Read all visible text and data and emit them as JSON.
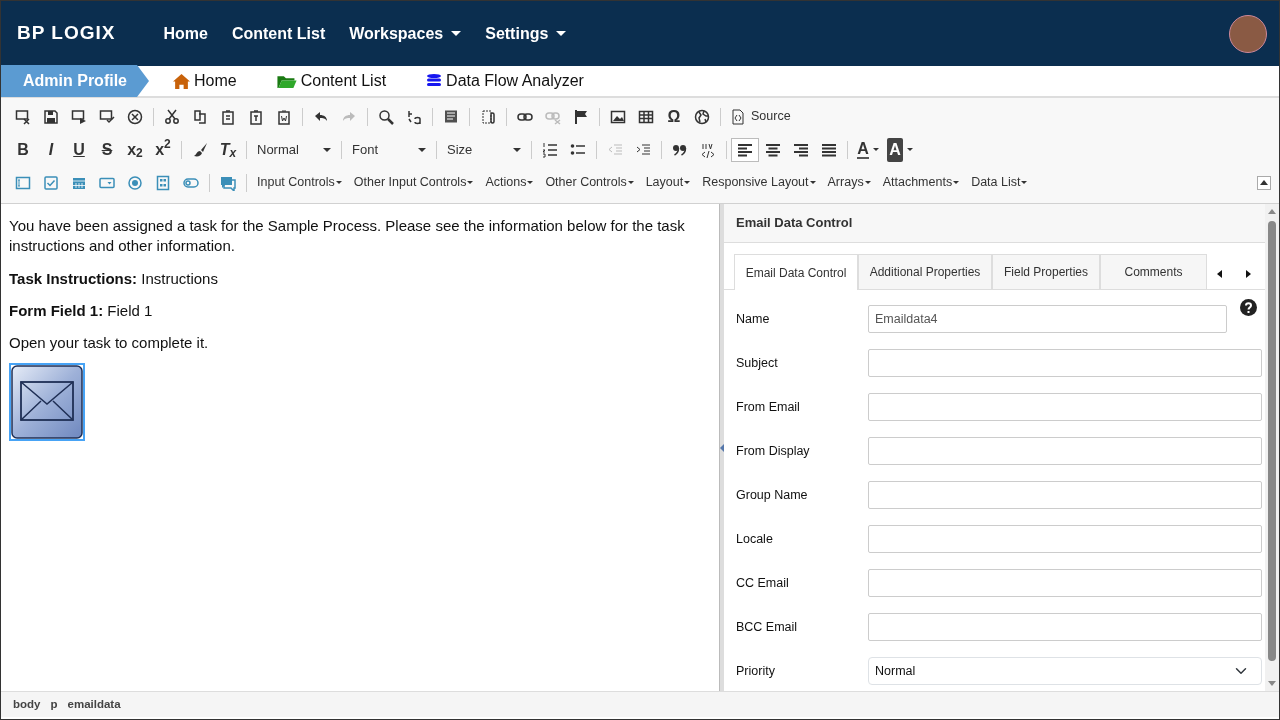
{
  "navbar": {
    "logo": "BP LOGIX",
    "items": [
      {
        "label": "Home",
        "dropdown": false
      },
      {
        "label": "Content List",
        "dropdown": false
      },
      {
        "label": "Workspaces",
        "dropdown": true
      },
      {
        "label": "Settings",
        "dropdown": true
      }
    ]
  },
  "breadcrumb": {
    "profile": "Admin Profile",
    "links": [
      {
        "label": "Home",
        "kind": "home"
      },
      {
        "label": "Content List",
        "kind": "folder"
      },
      {
        "label": "Data Flow Analyzer",
        "kind": "database"
      }
    ]
  },
  "toolbar": {
    "rows": [
      {
        "items": [
          {
            "kind": "icon",
            "disabled": false
          },
          {
            "kind": "icon",
            "disabled": false
          },
          {
            "kind": "icon",
            "disabled": false
          },
          {
            "kind": "icon",
            "disabled": false
          },
          {
            "kind": "icon",
            "disabled": false
          },
          {
            "kind": "separator"
          },
          {
            "kind": "icon",
            "disabled": false
          },
          {
            "kind": "icon",
            "disabled": false
          },
          {
            "kind": "icon",
            "disabled": false
          },
          {
            "kind": "icon",
            "disabled": false
          },
          {
            "kind": "icon",
            "disabled": false
          },
          {
            "kind": "separator"
          },
          {
            "kind": "icon",
            "disabled": false
          },
          {
            "kind": "icon",
            "disabled": true
          },
          {
            "kind": "separator"
          },
          {
            "kind": "icon",
            "disabled": false
          },
          {
            "kind": "icon",
            "disabled": false
          },
          {
            "kind": "separator"
          },
          {
            "kind": "icon",
            "disabled": false
          },
          {
            "kind": "separator"
          },
          {
            "kind": "icon",
            "disabled": false
          },
          {
            "kind": "separator"
          },
          {
            "kind": "icon",
            "disabled": false
          },
          {
            "kind": "icon",
            "disabled": true
          },
          {
            "kind": "icon",
            "disabled": false
          },
          {
            "kind": "separator"
          },
          {
            "kind": "icon",
            "disabled": false
          },
          {
            "kind": "icon",
            "disabled": false
          },
          {
            "kind": "glyph",
            "text": "Ω",
            "disabled": false
          },
          {
            "kind": "icon",
            "disabled": false
          },
          {
            "kind": "separator"
          },
          {
            "kind": "button",
            "label": "Source"
          }
        ]
      },
      {
        "items": [
          {
            "kind": "glyph",
            "text": "B",
            "disabled": false
          },
          {
            "kind": "glyph",
            "text": "I",
            "disabled": false
          },
          {
            "kind": "glyph",
            "text": "U",
            "disabled": false
          },
          {
            "kind": "glyph",
            "text": "S",
            "disabled": false
          },
          {
            "kind": "glyph",
            "text": "x$_{2}$",
            "disabled": false
          },
          {
            "kind": "glyph",
            "text": "x$^{2}$",
            "disabled": false
          },
          {
            "kind": "separator"
          },
          {
            "kind": "icon",
            "disabled": false
          },
          {
            "kind": "glyph",
            "text": "T$_{x}$",
            "disabled": false
          },
          {
            "kind": "separator"
          },
          {
            "kind": "dropdown",
            "label": "Normal"
          },
          {
            "kind": "separator"
          },
          {
            "kind": "dropdown",
            "label": "Font"
          },
          {
            "kind": "separator"
          },
          {
            "kind": "dropdown",
            "label": "Size"
          },
          {
            "kind": "separator"
          },
          {
            "kind": "icon",
            "disabled": false
          },
          {
            "kind": "icon",
            "disabled": false
          },
          {
            "kind": "separator"
          },
          {
            "kind": "icon",
            "disabled": true
          },
          {
            "kind": "icon",
            "disabled": false
          },
          {
            "kind": "separator"
          },
          {
            "kind": "icon",
            "disabled": false
          },
          {
            "kind": "icon",
            "disabled": false
          },
          {
            "kind": "separator"
          },
          {
            "kind": "icon",
            "disabled": false,
            "selected": true
          },
          {
            "kind": "icon",
            "disabled": false,
            "selected": false
          },
          {
            "kind": "icon",
            "disabled": false,
            "selected": false
          },
          {
            "kind": "icon",
            "disabled": false,
            "selected": false
          },
          {
            "kind": "separator"
          },
          {
            "kind": "color",
            "text": "A"
          },
          {
            "kind": "color",
            "text": "A"
          }
        ]
      },
      {
        "items": [
          {
            "kind": "icon",
            "disabled": false
          },
          {
            "kind": "icon",
            "disabled": false
          },
          {
            "kind": "icon",
            "disabled": false
          },
          {
            "kind": "icon",
            "disabled": false
          },
          {
            "kind": "icon",
            "disabled": false
          },
          {
            "kind": "icon",
            "disabled": false
          },
          {
            "kind": "icon",
            "disabled": false
          },
          {
            "kind": "separator"
          },
          {
            "kind": "icon",
            "disabled": false
          },
          {
            "kind": "separator"
          },
          {
            "kind": "menu",
            "label": "Input Controls"
          },
          {
            "kind": "menu",
            "label": "Other Input Controls"
          },
          {
            "kind": "menu",
            "label": "Actions"
          },
          {
            "kind": "menu",
            "label": "Other Controls"
          },
          {
            "kind": "menu",
            "label": "Layout"
          },
          {
            "kind": "menu",
            "label": "Responsive Layout"
          },
          {
            "kind": "menu",
            "label": "Arrays"
          },
          {
            "kind": "menu",
            "label": "Attachments"
          },
          {
            "kind": "menu",
            "label": "Data List"
          }
        ]
      }
    ]
  },
  "editor": {
    "paragraphs": [
      "You have been assigned a task for the Sample Process. Please see the information below for the task instructions and other information.",
      "**Task Instructions:** Instructions",
      "**Form Field 1:** Field 1",
      "Open your task to complete it."
    ],
    "email_control": {
      "selected": true
    }
  },
  "panel": {
    "title": "Email Data Control",
    "tabs": [
      {
        "label": "Email Data Control",
        "selected": true
      },
      {
        "label": "Additional Properties",
        "selected": false
      },
      {
        "label": "Field Properties",
        "selected": false
      },
      {
        "label": "Comments",
        "selected": false
      }
    ],
    "fields": [
      {
        "label": "Name",
        "kind": "text",
        "value": "Emaildata4",
        "help": true
      },
      {
        "label": "Subject",
        "kind": "text"
      },
      {
        "label": "From Email",
        "kind": "text"
      },
      {
        "label": "From Display",
        "kind": "text"
      },
      {
        "label": "Group Name",
        "kind": "text"
      },
      {
        "label": "Locale",
        "kind": "text"
      },
      {
        "label": "CC Email",
        "kind": "text"
      },
      {
        "label": "BCC Email",
        "kind": "text"
      },
      {
        "label": "Priority",
        "kind": "select",
        "value": "Normal"
      }
    ]
  },
  "status_bar": {
    "path": [
      "body",
      "p",
      "emaildata"
    ]
  }
}
